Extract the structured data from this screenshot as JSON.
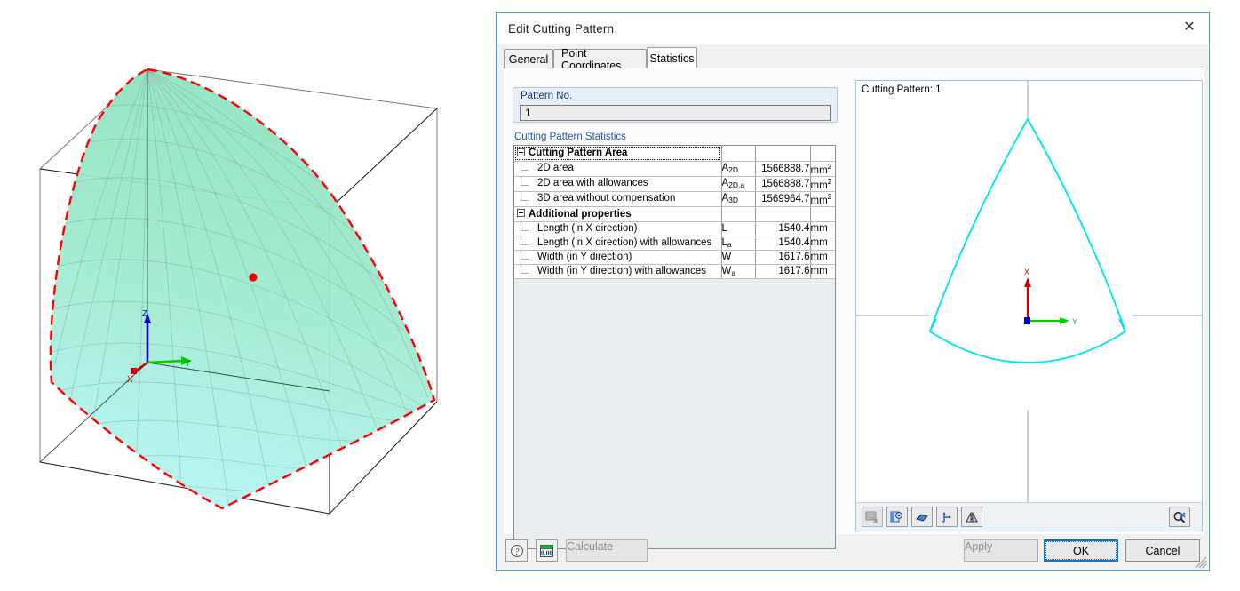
{
  "dialog": {
    "title": "Edit Cutting Pattern",
    "close_icon": "close-icon",
    "accent_color": "#3ba7e0"
  },
  "tabs": [
    {
      "label": "General",
      "active": false
    },
    {
      "label": "Point Coordinates",
      "active": false
    },
    {
      "label": "Statistics",
      "active": true
    }
  ],
  "form": {
    "pattern_no": {
      "caption_pre": "Pattern ",
      "caption_accel": "N",
      "caption_post": "o.",
      "value": "1"
    },
    "stats_caption": "Cutting Pattern Statistics"
  },
  "table": {
    "groups": [
      {
        "label": "Cutting Pattern Area",
        "focused": true,
        "rows": [
          {
            "desc": "2D area",
            "sym": "A",
            "sym_sub": "2D",
            "value": "1566888.7",
            "unit": "mm",
            "unit_sup": "2"
          },
          {
            "desc": "2D area with allowances",
            "sym": "A",
            "sym_sub": "2D,a",
            "value": "1566888.7",
            "unit": "mm",
            "unit_sup": "2"
          },
          {
            "desc": "3D area without compensation",
            "sym": "A",
            "sym_sub": "3D",
            "value": "1569964.7",
            "unit": "mm",
            "unit_sup": "2"
          }
        ]
      },
      {
        "label": "Additional properties",
        "focused": false,
        "rows": [
          {
            "desc": "Length (in X direction)",
            "sym": "L",
            "sym_sub": "",
            "value": "1540.4",
            "unit": "mm",
            "unit_sup": ""
          },
          {
            "desc": "Length (in X direction) with allowances",
            "sym": "L",
            "sym_sub": "a",
            "value": "1540.4",
            "unit": "mm",
            "unit_sup": ""
          },
          {
            "desc": "Width (in Y direction)",
            "sym": "W",
            "sym_sub": "",
            "value": "1617.6",
            "unit": "mm",
            "unit_sup": ""
          },
          {
            "desc": "Width (in Y direction) with allowances",
            "sym": "W",
            "sym_sub": "a",
            "value": "1617.6",
            "unit": "mm",
            "unit_sup": ""
          }
        ]
      }
    ]
  },
  "preview": {
    "label": "Cutting Pattern: 1",
    "shape_color": "#00e5ee",
    "axis_line_color": "#8aa8a8",
    "axes": {
      "x_label": "X",
      "x_color": "#cc0000",
      "y_label": "Y",
      "y_color": "#00cc00",
      "origin_color": "#0000cc"
    },
    "toolbar": [
      {
        "name": "render-mode-icon",
        "disabled": true
      },
      {
        "name": "view-settings-icon",
        "disabled": false
      },
      {
        "name": "surface-icon",
        "disabled": false
      },
      {
        "name": "axes-icon",
        "disabled": false
      },
      {
        "name": "mirror-icon",
        "disabled": false
      }
    ],
    "zoom_button": {
      "name": "zoom-all-icon"
    }
  },
  "footer": {
    "help_icon": "help-icon",
    "numeric_icon": "numeric-values-icon",
    "calculate": {
      "label": "Calculate",
      "enabled": false
    },
    "apply": {
      "label": "Apply",
      "enabled": false
    },
    "ok": {
      "label": "OK",
      "enabled": true,
      "focused": true
    },
    "cancel": {
      "label": "Cancel",
      "enabled": true
    }
  },
  "viewport3d": {
    "axes": {
      "z_label": "Z",
      "z_color": "#0000cc",
      "y_label": "Y",
      "y_color": "#00cc00",
      "x_label": "X",
      "x_color": "#cc0000"
    },
    "surface_fill_top": "#93e6c4",
    "surface_fill_bottom": "#b6f4f4",
    "boundary_color": "#ff0000",
    "mesh_color": "#8a9a9a",
    "node_marker_color": "#ee0000"
  }
}
